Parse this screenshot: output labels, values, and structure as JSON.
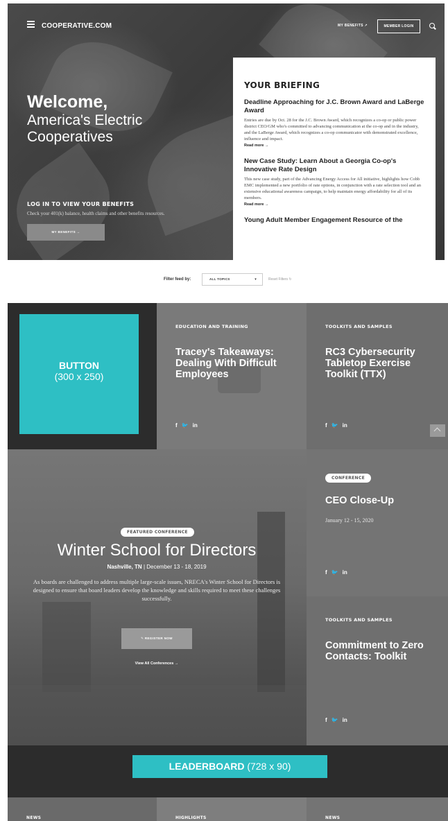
{
  "header": {
    "brand": "COOPERATIVE.COM",
    "my_benefits": "MY BENEFITS ↗",
    "member_login": "MEMBER LOGIN"
  },
  "hero": {
    "welcome_line1": "Welcome,",
    "welcome_line2": "America's Electric Cooperatives",
    "login_title": "LOG IN TO VIEW YOUR BENEFITS",
    "login_desc": "Check your 401(k) balance, health claims and other benefits resources.",
    "my_benefits_button": "MY BENEFITS →"
  },
  "briefing": {
    "title": "YOUR BRIEFING",
    "items": [
      {
        "headline": "Deadline Approaching for J.C. Brown Award and LaBerge Award",
        "body": "Entries are due by Oct. 28 for the J.C. Brown Award, which recognizes a co-op or public power district CEO/GM who's committed to advancing communication at the co-op and in the industry, and the LaBerge Award, which recognizes a co-op communicator with demonstrated excellence, influence and impact.",
        "more": "Read more →"
      },
      {
        "headline": "New Case Study: Learn About a Georgia Co-op's Innovative Rate Design",
        "body": "This new case study, part of the Advancing Energy Access for All initiative, highlights how Cobb EMC implemented a new portfolio of rate options, in conjunction with a rate selection tool and an extensive educational awareness campaign, to help maintain energy affordability for all of its members.",
        "more": "Read more →"
      },
      {
        "headline": "Young Adult Member Engagement Resource of the",
        "body": "",
        "more": ""
      }
    ]
  },
  "filter": {
    "label": "Filter feed by:",
    "selected": "ALL TOPICS",
    "reset": "Reset Filters ↻"
  },
  "ads": {
    "button_label": "BUTTON",
    "button_size": "(300 x 250)",
    "leaderboard_label": "LEADERBOARD",
    "leaderboard_size": "(728 x 90)"
  },
  "tiles": {
    "t1": {
      "category": "EDUCATION AND TRAINING",
      "title": "Tracey's Takeaways: Dealing With Difficult Employees"
    },
    "t2": {
      "category": "TOOLKITS AND SAMPLES",
      "title": "RC3 Cybersecurity Tabletop Exercise Toolkit (TTX)"
    },
    "t3": {
      "category": "CONFERENCE",
      "title": "CEO Close-Up",
      "date": "January 12 - 15, 2020"
    },
    "t4": {
      "category": "TOOLKITS AND SAMPLES",
      "title": "Commitment to Zero Contacts: Toolkit"
    }
  },
  "featured": {
    "pill": "FEATURED CONFERENCE",
    "title": "Winter School for Directors",
    "location": "Nashville, TN",
    "dates": "December 13 - 18, 2019",
    "description": "As boards are challenged to address multiple large-scale issues, NRECA's Winter School for Directors is designed to ensure that board leaders develop the knowledge and skills required to meet these challenges successfully.",
    "register": "✎ REGISTER NOW",
    "view_all": "View All Conferences →"
  },
  "social": {
    "facebook": "f",
    "twitter": "🐦",
    "linkedin": "in"
  },
  "bottom": {
    "c1": "NEWS",
    "c2": "HIGHLIGHTS",
    "c3": "NEWS"
  },
  "colors": {
    "accent": "#2ebfc4",
    "dark": "#2c2c2c",
    "mid": "#6e6e6e",
    "light": "#7c7c7c"
  }
}
